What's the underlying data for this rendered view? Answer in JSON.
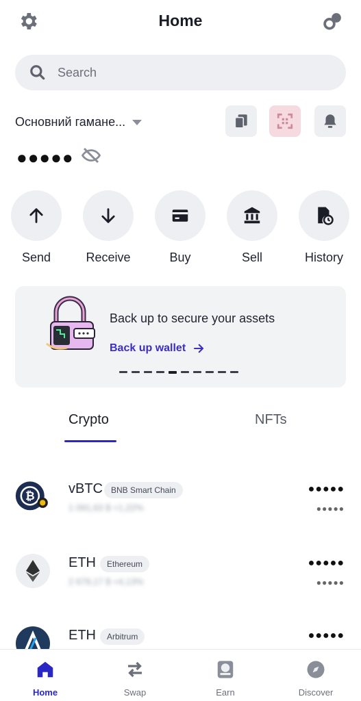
{
  "header": {
    "title": "Home",
    "settings_icon": "gear-icon",
    "connect_icon": "walletconnect-icon"
  },
  "search": {
    "placeholder": "Search"
  },
  "wallet": {
    "name": "Основний гамане...",
    "balance_masked": "●●●●●"
  },
  "actions": [
    {
      "label": "Send",
      "icon": "arrow-up-icon"
    },
    {
      "label": "Receive",
      "icon": "arrow-down-icon"
    },
    {
      "label": "Buy",
      "icon": "card-icon"
    },
    {
      "label": "Sell",
      "icon": "bank-icon"
    },
    {
      "label": "History",
      "icon": "history-icon"
    }
  ],
  "backup": {
    "title": "Back up to secure your assets",
    "link": "Back up wallet",
    "page_count": 10,
    "active_page": 4
  },
  "tabs": [
    {
      "label": "Crypto",
      "active": true
    },
    {
      "label": "NFTs",
      "active": false
    }
  ],
  "assets": [
    {
      "symbol": "vBTC",
      "chain": "BNB Smart Chain",
      "price": "1 091,63 $ +1,22%",
      "balance": "●●●●●",
      "value": "●●●●●"
    },
    {
      "symbol": "ETH",
      "chain": "Ethereum",
      "price": "2 679,17 $ +4,13%",
      "balance": "●●●●●",
      "value": "●●●●●"
    },
    {
      "symbol": "ETH",
      "chain": "Arbitrum",
      "price": "",
      "balance": "●●●●●",
      "value": "●●●●●"
    }
  ],
  "nav": [
    {
      "label": "Home",
      "active": true
    },
    {
      "label": "Swap",
      "active": false
    },
    {
      "label": "Earn",
      "active": false
    },
    {
      "label": "Discover",
      "active": false
    }
  ],
  "colors": {
    "accent": "#2a27c4",
    "surface": "#eeeff2",
    "text": "#1f2330"
  }
}
